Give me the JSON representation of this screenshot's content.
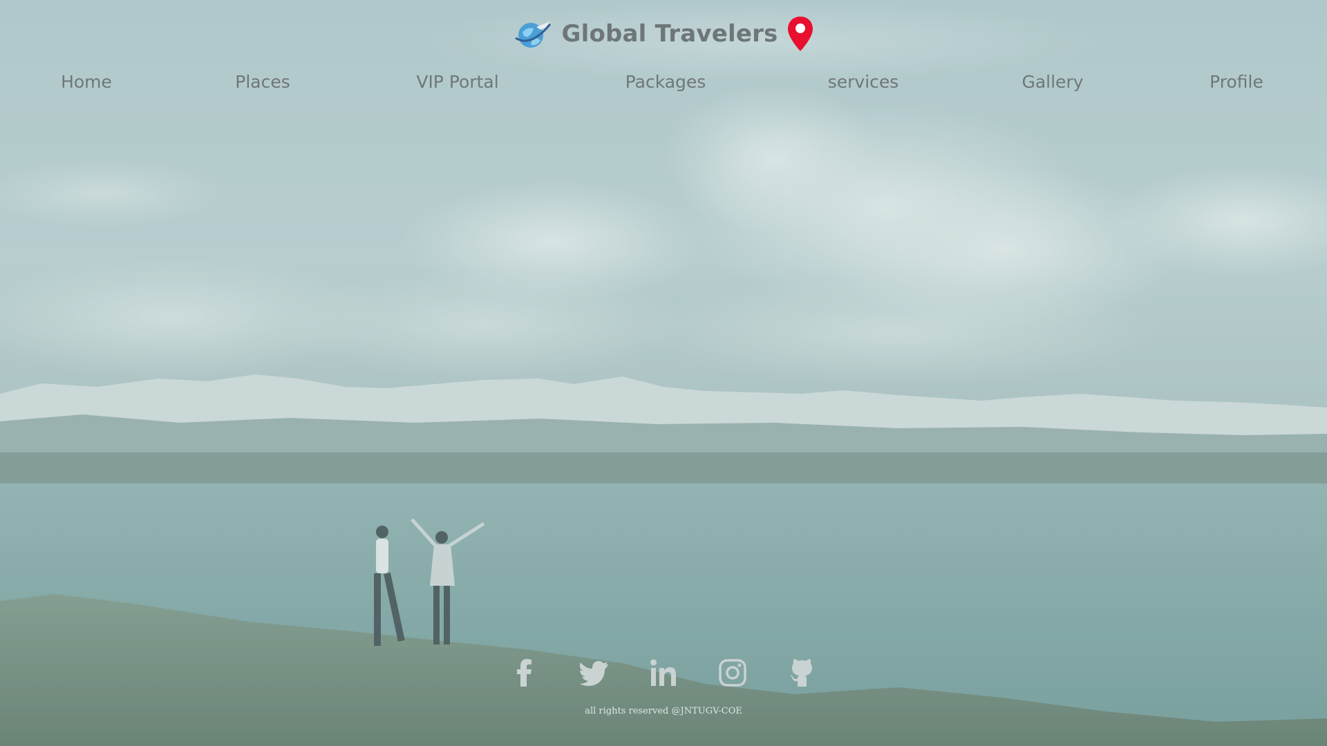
{
  "brand": {
    "name": "Global Travelers"
  },
  "nav": {
    "items": [
      {
        "label": "Home"
      },
      {
        "label": "Places"
      },
      {
        "label": "VIP Portal"
      },
      {
        "label": "Packages"
      },
      {
        "label": "services"
      },
      {
        "label": "Gallery"
      },
      {
        "label": "Profile"
      }
    ]
  },
  "social": {
    "items": [
      {
        "icon": "facebook-icon"
      },
      {
        "icon": "twitter-icon"
      },
      {
        "icon": "linkedin-icon"
      },
      {
        "icon": "instagram-icon"
      },
      {
        "icon": "github-icon"
      }
    ]
  },
  "footer": {
    "text": "all rights reserved @JNTUGV-COE"
  },
  "colors": {
    "nav_text": "#6f7779",
    "brand_text": "#6e7679",
    "pin": "#e8102e",
    "overlay": "#a8c6c8"
  }
}
